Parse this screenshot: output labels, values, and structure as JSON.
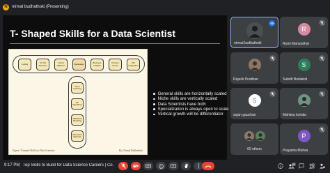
{
  "presenter": {
    "initial": "N",
    "label": "nirmal budhathoki (Presenting)"
  },
  "slide": {
    "title": "T- Shaped Skills for a Data Scientist",
    "figure": {
      "general_skills": [
        "Coding",
        "Cl/ CD Services",
        "Cloud Platform",
        "Databases",
        "Business Insights",
        "Product Sense",
        "API Integration"
      ],
      "niche_skills": [
        "Deep Learning",
        "ML Algorithms",
        "Statistical Modeling",
        "Research Methods"
      ],
      "caption": "Figure: T-shaped Skills for Data Scientists",
      "credit": "By: Nirmal Budhathoki"
    },
    "bullets": [
      "General skills are horizontally scaled",
      "Niche skills are vertically scaled",
      "Data Scientists have both",
      "Specialization is always open to scale",
      "Vertical growth will be differentiator"
    ]
  },
  "participants": [
    {
      "name": "nirmal budhathoki",
      "type": "photo",
      "color": "#555a5f",
      "active": true,
      "status": "speaking"
    },
    {
      "name": "Rumi Manandhar",
      "type": "initial",
      "initial": "R",
      "color": "#d48aa0",
      "status": "muted"
    },
    {
      "name": "Rojesh Pradhan",
      "type": "photo",
      "color": "#6b5b4e",
      "status": "muted"
    },
    {
      "name": "Subritt Burlakoti",
      "type": "initial",
      "initial": "S",
      "color": "#2e7d5b",
      "status": "muted"
    },
    {
      "name": "sujan gauchan",
      "type": "initial",
      "initial": "S",
      "color": "#ffffff",
      "status": "muted"
    },
    {
      "name": "Mahima koirala",
      "type": "photo",
      "color": "#4e7a6a",
      "status": "muted"
    },
    {
      "name": "60 others",
      "type": "others",
      "status": "none"
    },
    {
      "name": "Prayatna Mishra",
      "type": "initial",
      "initial": "P",
      "color": "#7e57c2",
      "status": "muted"
    }
  ],
  "bottom_bar": {
    "time": "9:17 PM",
    "separator": "|",
    "meeting_title": "Top Skills to Build for Data Science Careers | Co...",
    "people_count": "63"
  },
  "colors": {
    "leave_red": "#ea4335",
    "accent_blue": "#8ab4f8",
    "tile_bg": "#3c4043"
  }
}
